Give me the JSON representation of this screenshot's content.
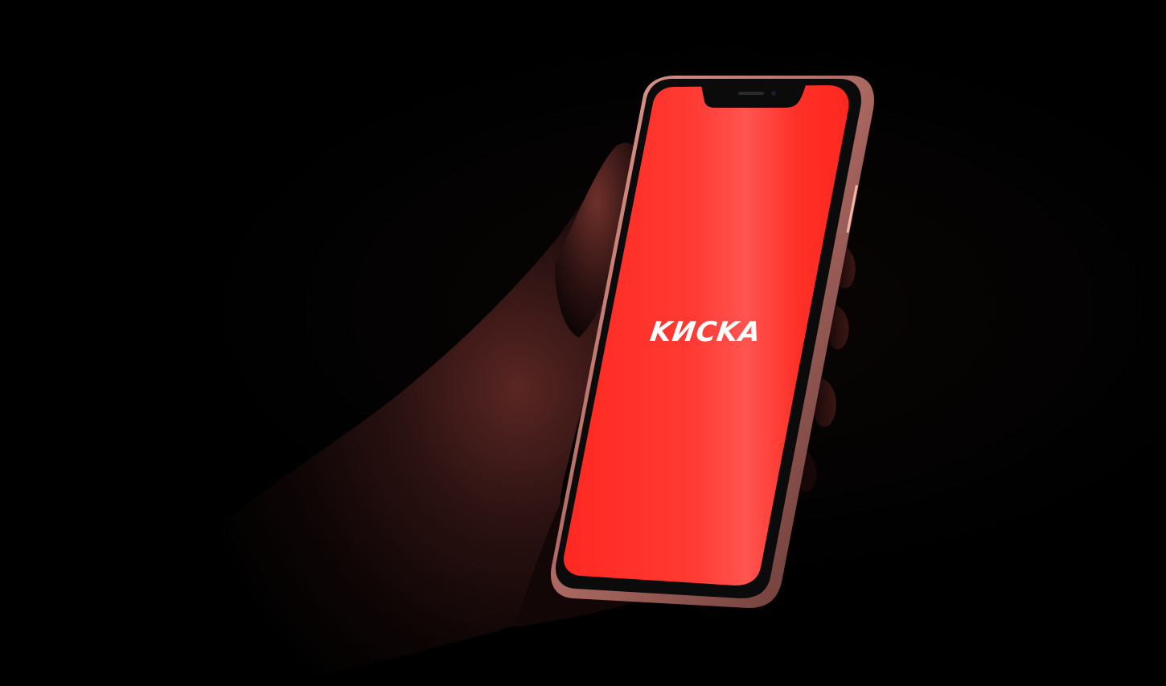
{
  "screen": {
    "logo_text": "KИCKA",
    "background_color": "#ff2a22",
    "logo_color": "#ffffff"
  },
  "device": {
    "frame_color": "#c9867a",
    "bezel_color": "#0b0b0b"
  },
  "scene": {
    "background_color": "#000000"
  }
}
